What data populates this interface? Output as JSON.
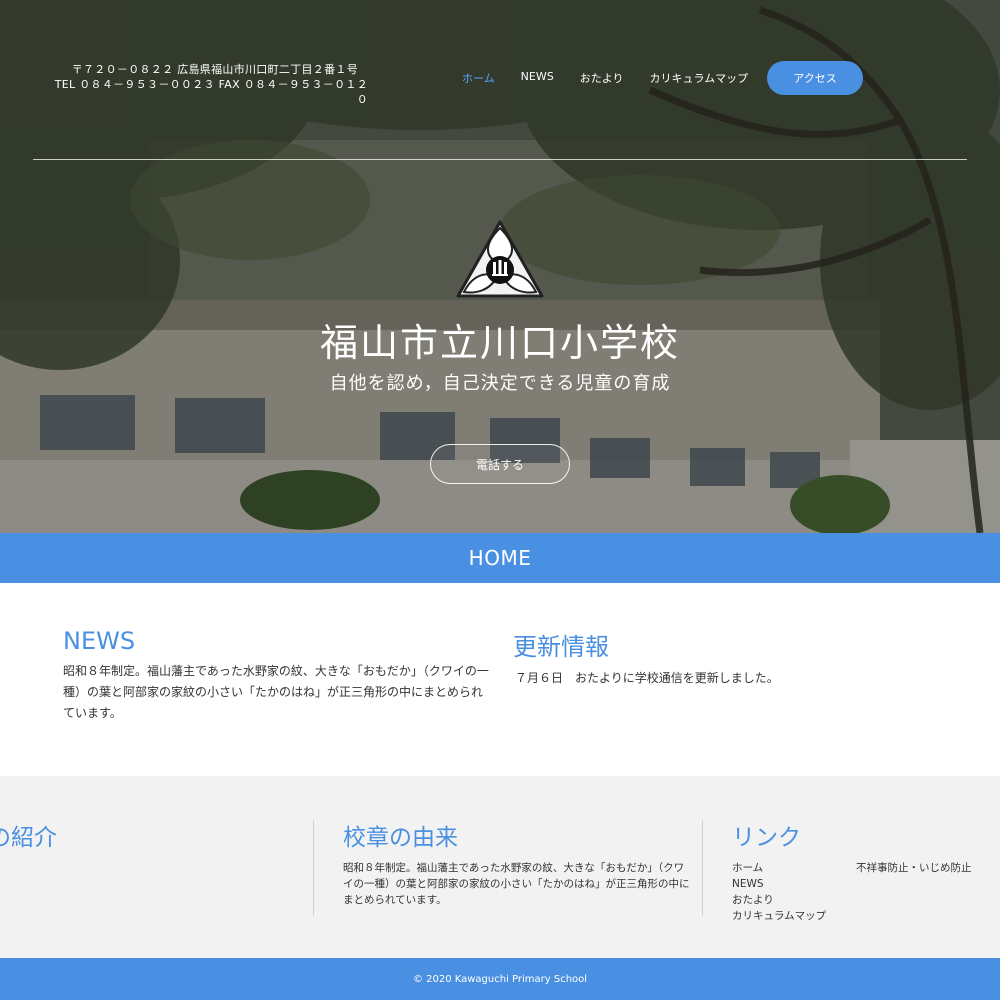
{
  "header": {
    "address_line1": "〒７２０－０８２２ 広島県福山市川口町二丁目２番１号",
    "address_line2": "TEL ０８４－９５３－００２３ FAX ０８４－９５３－０１２０",
    "nav": [
      {
        "label": "ホーム",
        "active": true
      },
      {
        "label": "NEWS"
      },
      {
        "label": "おたより"
      },
      {
        "label": "カリキュラムマップ"
      }
    ],
    "access_label": "アクセス"
  },
  "hero": {
    "school_name": "福山市立川口小学校",
    "motto": "自他を認め，自己決定できる児童の育成",
    "call_label": "電話する"
  },
  "home_bar": {
    "label": "HOME"
  },
  "news": {
    "heading": "NEWS",
    "text": "昭和８年制定。福山藩主であった水野家の紋、大きな「おもだか」（クワイの一種）の葉と阿部家の家紋の小さい「たかのはね」が正三角形の中にまとめられています。"
  },
  "updates": {
    "heading": "更新情報",
    "text": "７月６日　おたよりに学校通信を更新しました。"
  },
  "info": {
    "intro_heading": "の紹介",
    "emblem_heading": "校章の由来",
    "emblem_text": "昭和８年制定。福山藩主であった水野家の紋、大きな「おもだか」（クワイの一種）の葉と阿部家の家紋の小さい「たかのはね」が正三角形の中にまとめられています。",
    "links_heading": "リンク",
    "links_col1": [
      "ホーム",
      "NEWS",
      "おたより",
      "カリキュラムマップ"
    ],
    "links_col2": [
      "不祥事防止・いじめ防止"
    ]
  },
  "footer": {
    "copyright": "© 2020 Kawaguchi Primary School"
  },
  "colors": {
    "accent": "#4a90e2",
    "nav_active": "#5aa0ff",
    "info_bg": "#f2f2f2"
  }
}
